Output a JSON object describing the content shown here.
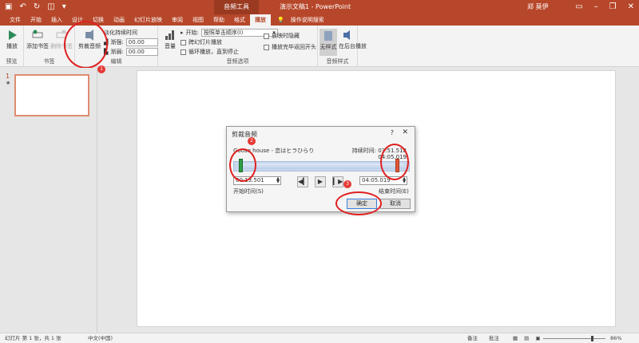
{
  "titlebar": {
    "context_tab": "音频工具",
    "doc_title": "演示文稿1 - PowerPoint",
    "user": "郑 莫伊"
  },
  "tabs": {
    "items": [
      "文件",
      "开始",
      "插入",
      "设计",
      "切换",
      "动画",
      "幻灯片放映",
      "审阅",
      "视图",
      "帮助",
      "格式",
      "播放"
    ],
    "active": "播放",
    "tell_me": "操作说明搜索"
  },
  "ribbon": {
    "preview": {
      "play": "播放",
      "label": "预览"
    },
    "bookmarks": {
      "add": "添加书签",
      "remove": "删除书签",
      "label": "书签"
    },
    "editing": {
      "trim": "剪裁音频",
      "fade_duration": "淡化持续时间",
      "fade_in": "渐强:",
      "fade_in_value": "00.00",
      "fade_out": "渐弱:",
      "fade_out_value": "00.00",
      "label": "编辑"
    },
    "audio_options": {
      "volume": "音量",
      "start": "开始:",
      "start_value": "按照单击顺序(I)",
      "across_slides": "跨幻灯片播放",
      "loop": "循环播放，直到停止",
      "hide": "放映时隐藏",
      "rewind": "播放完毕返回开头",
      "label": "音频选项"
    },
    "audio_styles": {
      "none": "无样式",
      "background": "在后台播放",
      "label": "音频样式"
    }
  },
  "annotations": [
    "1",
    "2",
    "3"
  ],
  "thumbs": {
    "slide_num": "1",
    "star": "★"
  },
  "dialog": {
    "title": "剪裁音频",
    "help": "?",
    "close": "✕",
    "track_name": "Goose house - 恋はヒラひらり",
    "duration": "持续时间: 03:51.518",
    "current_time": "04:05.019",
    "start_time_value": "00:13.501",
    "end_time_value": "04:05.019",
    "start_label": "开始时间(S)",
    "end_label": "结束时间(E)",
    "ok": "确定",
    "cancel": "取消"
  },
  "statusbar": {
    "slide_info": "幻灯片 第 1 张，共 1 张",
    "language": "中文(中国)",
    "notes": "备注",
    "comments": "批注",
    "zoom": "86%"
  },
  "colors": {
    "brand": "#b7472a",
    "annotation": "#e02020",
    "start_handle": "#2e9e44",
    "end_handle": "#e05638"
  }
}
